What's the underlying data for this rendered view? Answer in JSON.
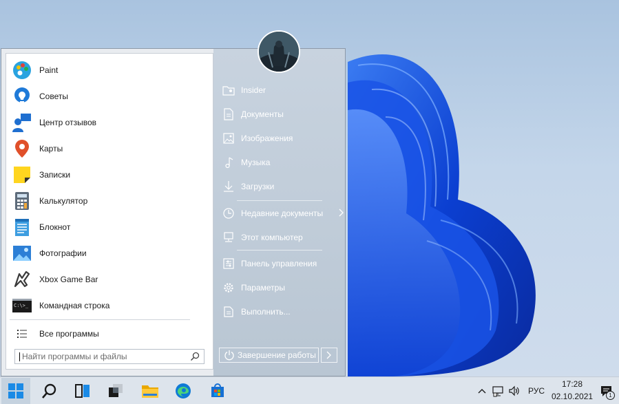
{
  "start_menu": {
    "apps": [
      {
        "label": "Paint",
        "icon": "paint-icon"
      },
      {
        "label": "Советы",
        "icon": "tips-icon"
      },
      {
        "label": "Центр отзывов",
        "icon": "feedback-hub-icon"
      },
      {
        "label": "Карты",
        "icon": "maps-icon"
      },
      {
        "label": "Записки",
        "icon": "sticky-notes-icon"
      },
      {
        "label": "Калькулятор",
        "icon": "calculator-icon"
      },
      {
        "label": "Блокнот",
        "icon": "notepad-icon"
      },
      {
        "label": "Фотографии",
        "icon": "photos-icon"
      },
      {
        "label": "Xbox Game Bar",
        "icon": "xbox-game-bar-icon"
      },
      {
        "label": "Командная строка",
        "icon": "command-prompt-icon"
      }
    ],
    "all_programs": "Все программы",
    "search_placeholder": "Найти программы и файлы",
    "cmd_glyph": "C:\\>_",
    "places": [
      {
        "label": "Insider",
        "icon": "user-folder-icon"
      },
      {
        "label": "Документы",
        "icon": "documents-icon"
      },
      {
        "label": "Изображения",
        "icon": "pictures-icon"
      },
      {
        "label": "Музыка",
        "icon": "music-icon"
      },
      {
        "label": "Загрузки",
        "icon": "downloads-icon"
      },
      {
        "label": "Недавние документы",
        "icon": "recent-icon"
      },
      {
        "label": "Этот компьютер",
        "icon": "computer-icon"
      },
      {
        "label": "Панель управления",
        "icon": "control-panel-icon"
      },
      {
        "label": "Параметры",
        "icon": "settings-icon"
      },
      {
        "label": "Выполнить...",
        "icon": "run-icon"
      }
    ],
    "shutdown_label": "Завершение работы"
  },
  "taskbar": {
    "language": "РУС",
    "time": "17:28",
    "date": "02.10.2021",
    "notification_count": "1",
    "pinned": [
      "start-icon",
      "search-icon",
      "task-view-icon",
      "widgets-icon",
      "file-explorer-icon",
      "edge-icon",
      "store-icon"
    ]
  },
  "colors": {
    "accent": "#0a6fd6",
    "wallpaper_blue": "#0b3fd1",
    "menu_right_pane": "#bfcad6"
  }
}
